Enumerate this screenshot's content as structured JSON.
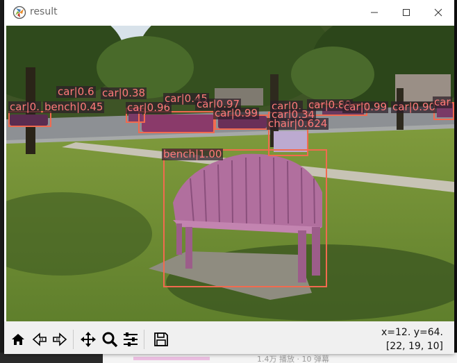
{
  "window": {
    "title": "result",
    "controls": [
      "minimize-icon",
      "maximize-icon",
      "close-icon"
    ]
  },
  "detections": [
    {
      "label": "car|0.",
      "color": "#f26a4f"
    },
    {
      "label": "bench|0.45",
      "color": "#f26a4f"
    },
    {
      "label": "car|0.6",
      "color": "#f26a4f"
    },
    {
      "label": "car|0.38",
      "color": "#f26a4f"
    },
    {
      "label": "car|0.96",
      "color": "#f26a4f"
    },
    {
      "label": "car|0.45",
      "color": "#f26a4f"
    },
    {
      "label": "car|0.97",
      "color": "#f26a4f"
    },
    {
      "label": "car|0.99",
      "color": "#f26a4f"
    },
    {
      "label": "car|0.",
      "color": "#f26a4f"
    },
    {
      "label": "car|0.34",
      "color": "#f26a4f"
    },
    {
      "label": "car|0.89",
      "color": "#f26a4f"
    },
    {
      "label": "car|0.99",
      "color": "#f26a4f"
    },
    {
      "label": "car|0.90",
      "color": "#f26a4f"
    },
    {
      "label": "car",
      "color": "#f26a4f"
    },
    {
      "label": "chair|0.624",
      "color": "#f26a4f"
    },
    {
      "label": "bench|1.00",
      "color": "#f26a4f"
    }
  ],
  "toolbar": {
    "buttons": [
      "home-icon",
      "back-icon",
      "forward-icon",
      "pan-icon",
      "zoom-icon",
      "configure-subplots-icon",
      "save-icon"
    ]
  },
  "status": {
    "coords": "x=12. y=64.",
    "pixel_value": "[22, 19, 10]"
  },
  "desktop": {
    "taskbar_text": "1.4万 播放 · 10 弹幕"
  }
}
